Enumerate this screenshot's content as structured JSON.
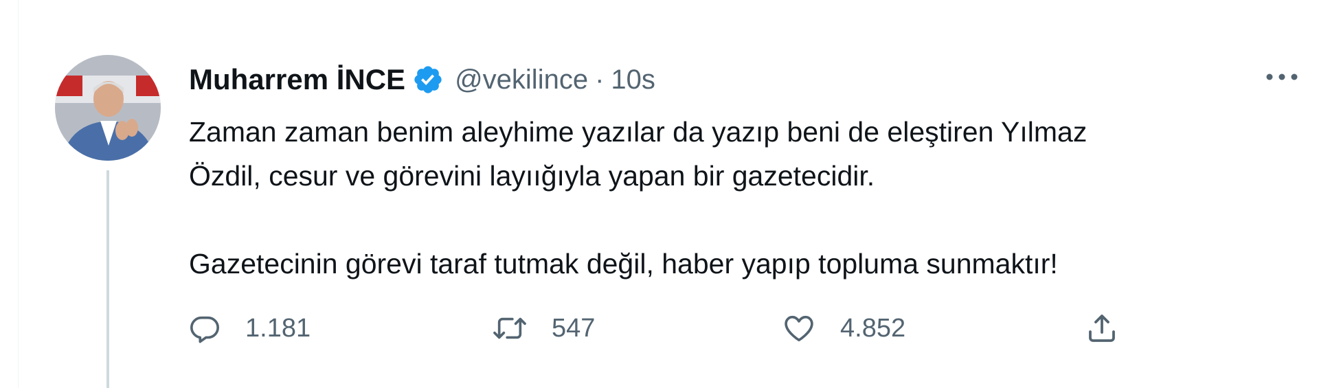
{
  "tweet": {
    "author": {
      "display_name": "Muharrem İNCE",
      "handle": "@vekilince",
      "verified_icon": "verified-badge-icon"
    },
    "separator": "·",
    "time": "10s",
    "more_icon": "more-horizontal-icon",
    "text_lines": [
      "Zaman zaman benim aleyhime yazılar da yazıp beni de eleştiren Yılmaz",
      "Özdil, cesur ve görevini layıığıyla yapan bir gazetecidir.",
      "Gazetecinin görevi taraf tutmak değil, haber yapıp topluma sunmaktır!"
    ],
    "actions": {
      "reply": {
        "icon": "reply-icon",
        "count": "1.181"
      },
      "retweet": {
        "icon": "retweet-icon",
        "count": "547"
      },
      "like": {
        "icon": "heart-icon",
        "count": "4.852"
      },
      "share": {
        "icon": "share-icon"
      }
    }
  },
  "colors": {
    "text_primary": "#0f1419",
    "text_secondary": "#536471",
    "verified_blue": "#1d9bf0",
    "thread_line": "#cfd9de"
  }
}
